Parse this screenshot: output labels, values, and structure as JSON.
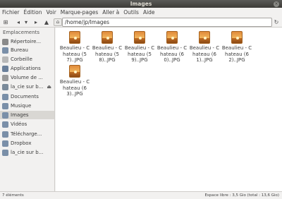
{
  "window": {
    "title": "Images",
    "close_glyph": "×"
  },
  "menu": [
    "Fichier",
    "Édition",
    "Voir",
    "Marque-pages",
    "Aller à",
    "Outils",
    "Aide"
  ],
  "toolbar": {
    "new_tab_icon": "⊞",
    "back_icon": "◂",
    "back_dropdown_icon": "▾",
    "forward_icon": "▸",
    "up_icon": "▲",
    "home_icon": "⌂",
    "path": "/home/jp/Images",
    "reload_icon": "↻"
  },
  "sidebar": {
    "heading": "Emplacements",
    "items": [
      {
        "label": "Répertoire...",
        "icon": "home-folder-icon",
        "color": "#8a8a8a"
      },
      {
        "label": "Bureau",
        "icon": "desktop-folder-icon",
        "color": "#7a8fa8"
      },
      {
        "label": "Corbeille",
        "icon": "trash-icon",
        "color": "#b8b8b8"
      },
      {
        "label": "Applications",
        "icon": "applications-icon",
        "color": "#6a7f9a"
      },
      {
        "label": "Volume de ...",
        "icon": "drive-icon",
        "color": "#9a9a9a"
      },
      {
        "label": "la_cie sur b...",
        "icon": "network-drive-icon",
        "color": "#7a8a9a",
        "eject": "⏏"
      },
      {
        "label": "Documents",
        "icon": "documents-folder-icon",
        "color": "#7a8fa8"
      },
      {
        "label": "Musique",
        "icon": "music-folder-icon",
        "color": "#7a8fa8"
      },
      {
        "label": "Images",
        "icon": "pictures-folder-icon",
        "color": "#7a8fa8",
        "selected": true
      },
      {
        "label": "Vidéos",
        "icon": "videos-folder-icon",
        "color": "#7a8fa8"
      },
      {
        "label": "Télécharge...",
        "icon": "downloads-folder-icon",
        "color": "#7a8fa8"
      },
      {
        "label": "Dropbox",
        "icon": "dropbox-folder-icon",
        "color": "#7a8fa8"
      },
      {
        "label": "la_cie sur b...",
        "icon": "network-folder-icon",
        "color": "#7a8fa8"
      }
    ]
  },
  "files": [
    {
      "name": "Beaulieu - Chateau (57)..JPG"
    },
    {
      "name": "Beaulieu - Chateau (58)..JPG"
    },
    {
      "name": "Beaulieu - Chateau (59)..JPG"
    },
    {
      "name": "Beaulieu - Chateau (60)..JPG"
    },
    {
      "name": "Beaulieu - Chateau (61)..JPG"
    },
    {
      "name": "Beaulieu - Chateau (62)..JPG"
    },
    {
      "name": "Beaulieu - Chateau (63)..JPG"
    }
  ],
  "status": {
    "left": "7 éléments",
    "right": "Espace libre : 3,5 Gio (total : 13,6 Gio)"
  }
}
